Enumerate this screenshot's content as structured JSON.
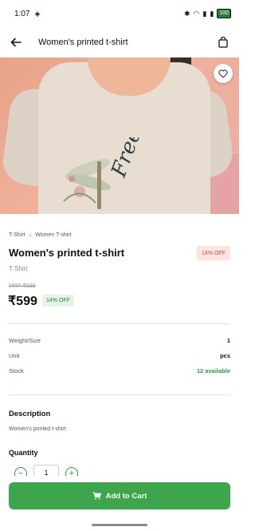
{
  "status_bar": {
    "time": "1:07",
    "battery": "100"
  },
  "app_bar": {
    "title": "Women's printed t-shirt",
    "icons": [
      "back-arrow-icon",
      "shopping-bag-icon"
    ]
  },
  "hero": {
    "favorite_icon": "heart-outline-icon",
    "print_text": "Free"
  },
  "breadcrumb": [
    "T-Shirt",
    "Women T-shirt"
  ],
  "product": {
    "name": "Women's printed t-shirt",
    "discount_badge": "14% OFF",
    "category": "T-Shirt",
    "mrp": "MRP ₹699",
    "price": "₹599",
    "off_badge": "14% OFF"
  },
  "specs": [
    {
      "label": "Weight/Size",
      "value": "1"
    },
    {
      "label": "Unit",
      "value": "pcs"
    },
    {
      "label": "Stock",
      "value": "12 available"
    }
  ],
  "description": {
    "heading": "Description",
    "text": "Women's printed t-shirt"
  },
  "quantity": {
    "heading": "Quantity",
    "value": "1"
  },
  "cta": {
    "label": "Add to Cart",
    "icon": "cart-icon"
  },
  "colors": {
    "accent": "#3da64d",
    "discount_bg": "#fde4e1",
    "discount_text": "#d84a3a",
    "stock_text": "#2e9a3a"
  }
}
